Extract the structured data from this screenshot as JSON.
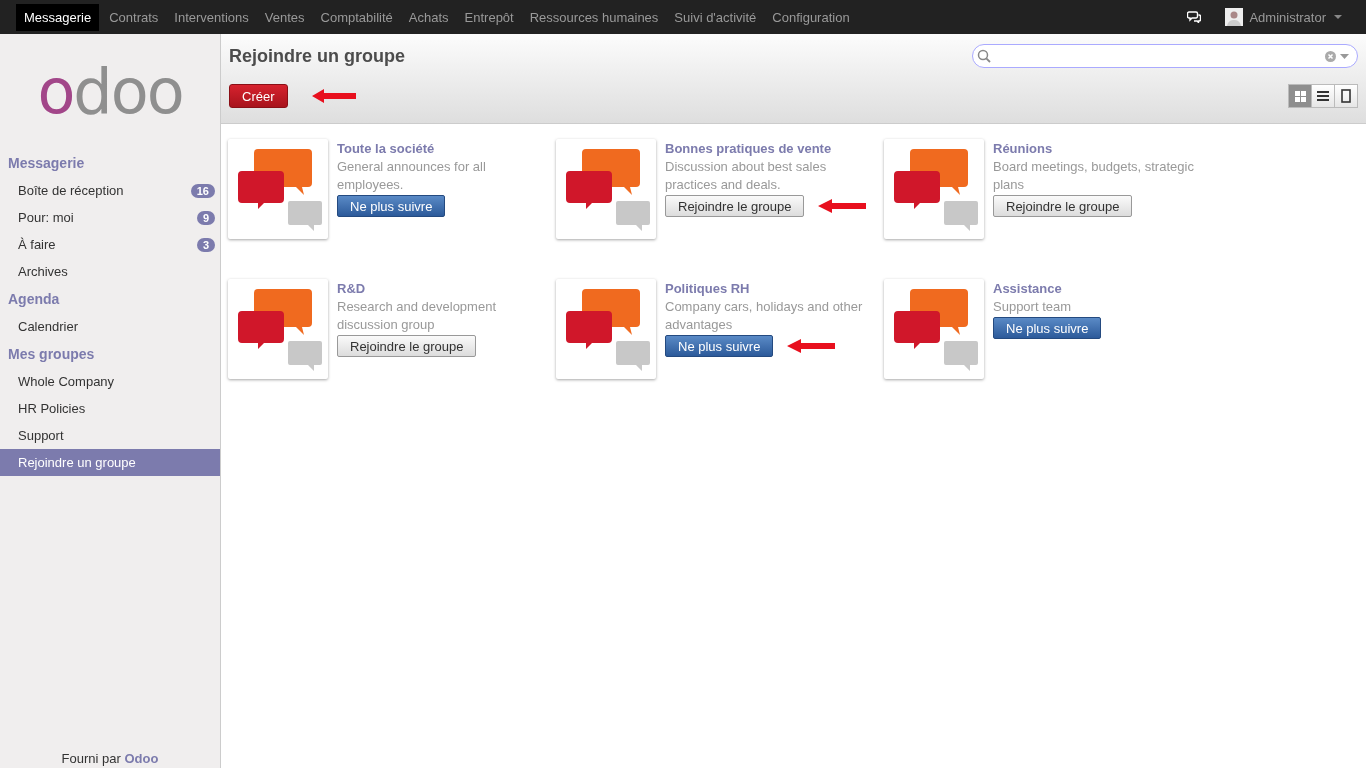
{
  "top_menu": [
    {
      "label": "Messagerie",
      "selected": true
    },
    {
      "label": "Contrats",
      "selected": false
    },
    {
      "label": "Interventions",
      "selected": false
    },
    {
      "label": "Ventes",
      "selected": false
    },
    {
      "label": "Comptabilité",
      "selected": false
    },
    {
      "label": "Achats",
      "selected": false
    },
    {
      "label": "Entrepôt",
      "selected": false
    },
    {
      "label": "Ressources humaines",
      "selected": false
    },
    {
      "label": "Suivi d'activité",
      "selected": false
    },
    {
      "label": "Configuration",
      "selected": false
    }
  ],
  "user": {
    "name": "Administrator"
  },
  "sidebar": {
    "logo": "odoo",
    "sections": [
      {
        "title": "Messagerie",
        "items": [
          {
            "label": "Boîte de réception",
            "badge": "16",
            "selected": false
          },
          {
            "label": "Pour: moi",
            "badge": "9",
            "selected": false
          },
          {
            "label": "À faire",
            "badge": "3",
            "selected": false
          },
          {
            "label": "Archives",
            "selected": false
          }
        ]
      },
      {
        "title": "Agenda",
        "items": [
          {
            "label": "Calendrier",
            "selected": false
          }
        ]
      },
      {
        "title": "Mes groupes",
        "items": [
          {
            "label": "Whole Company",
            "selected": false
          },
          {
            "label": "HR Policies",
            "selected": false
          },
          {
            "label": "Support",
            "selected": false
          },
          {
            "label": "Rejoindre un groupe",
            "selected": true
          }
        ]
      }
    ],
    "footer": {
      "text": "Fourni par",
      "link": "Odoo"
    }
  },
  "page": {
    "title": "Rejoindre un groupe",
    "create_button": {
      "label": "Créer",
      "marked": true
    },
    "views": [
      {
        "kind": "kanban",
        "selected": true
      },
      {
        "kind": "list",
        "selected": false
      },
      {
        "kind": "form",
        "selected": false
      }
    ]
  },
  "groups": [
    {
      "name": "Toute la société",
      "description": "General announces for all employees.",
      "button": "Ne plus suivre",
      "followed": true,
      "marked": false
    },
    {
      "name": "Bonnes pratiques de vente",
      "description": "Discussion about best sales practices and deals.",
      "button": "Rejoindre le groupe",
      "followed": false,
      "marked": true
    },
    {
      "name": "Réunions",
      "description": "Board meetings, budgets, strategic plans",
      "button": "Rejoindre le groupe",
      "followed": false,
      "marked": false
    },
    {
      "name": "R&D",
      "description": "Research and development discussion group",
      "button": "Rejoindre le groupe",
      "followed": false,
      "marked": false
    },
    {
      "name": "Politiques RH",
      "description": "Company cars, holidays and other advantages",
      "button": "Ne plus suivre",
      "followed": true,
      "marked": true
    },
    {
      "name": "Assistance",
      "description": "Support team",
      "button": "Ne plus suivre",
      "followed": true,
      "marked": false
    }
  ]
}
